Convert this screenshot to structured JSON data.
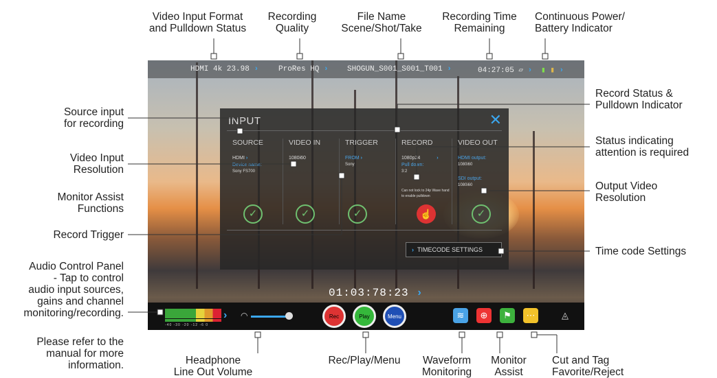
{
  "annotations": {
    "video_input_format": [
      "Video Input Format",
      "and Pulldown Status"
    ],
    "recording_quality": [
      "Recording",
      "Quality"
    ],
    "file_name": [
      "File Name",
      "Scene/Shot/Take"
    ],
    "recording_time": [
      "Recording Time",
      "Remaining"
    ],
    "power": [
      "Continuous Power/",
      "Battery Indicator"
    ],
    "source_input": [
      "Source input",
      "for recording"
    ],
    "video_input_resolution": [
      "Video Input",
      "Resolution"
    ],
    "monitor_assist_functions": [
      "Monitor Assist",
      "Functions"
    ],
    "record_trigger": [
      "Record Trigger"
    ],
    "audio_control": [
      "Audio Control Panel",
      "- Tap to control",
      "audio input sources,",
      "gains and channel",
      "monitoring/recording."
    ],
    "manual_note": [
      "Please refer to the",
      "manual for more",
      "information."
    ],
    "record_status": [
      "Record Status &",
      "Pulldown Indicator"
    ],
    "status_attention": [
      "Status indicating",
      "attention is required"
    ],
    "output_video": [
      "Output Video",
      "Resolution"
    ],
    "timecode_settings": [
      "Time code Settings"
    ],
    "headphone": [
      "Headphone",
      "Line Out Volume"
    ],
    "rec_play_menu": [
      "Rec/Play/Menu"
    ],
    "waveform": [
      "Waveform",
      "Monitoring"
    ],
    "monitor_assist": [
      "Monitor",
      "Assist"
    ],
    "cut_tag": [
      "Cut and Tag",
      "Favorite/Reject"
    ]
  },
  "topbar": {
    "input": "HDMI 4k 23.98",
    "quality": "ProRes HQ",
    "filename": "SHOGUN_S001_S001_T001",
    "time": "04:27:05"
  },
  "panel": {
    "title": "INPUT",
    "close": "✕",
    "source": {
      "header": "SOURCE",
      "value": "HDMI",
      "label": "Device name:",
      "device": "Sony FS700"
    },
    "video_in": {
      "header": "VIDEO IN",
      "value": "1080i60"
    },
    "trigger": {
      "header": "TRIGGER",
      "from": "FROM",
      "device": "Sony"
    },
    "record": {
      "header": "RECORD",
      "value": "1080p24",
      "pulldown_label": "Pull down:",
      "pulldown": "3:2",
      "warning": "Can not lock to 24p Wave hand to enable pulldown"
    },
    "video_out": {
      "header": "VIDEO OUT",
      "hdmi_label": "HDMI output:",
      "hdmi": "1080i60",
      "sdi_label": "SDI output:",
      "sdi": "1080i60"
    },
    "timecode_button": "TIMECODE SETTINGS"
  },
  "screen": {
    "timecode": "01:03:78:23",
    "meter_scale": "-40 -30 -20 -12 -6 0",
    "rec": "Rec",
    "play": "Play",
    "menu": "Menu"
  },
  "colors": {
    "accent": "#3ba7f0",
    "ok": "#6fc070",
    "rec": "#d33333",
    "play": "#35b83b",
    "menu": "#1f4fb5"
  }
}
